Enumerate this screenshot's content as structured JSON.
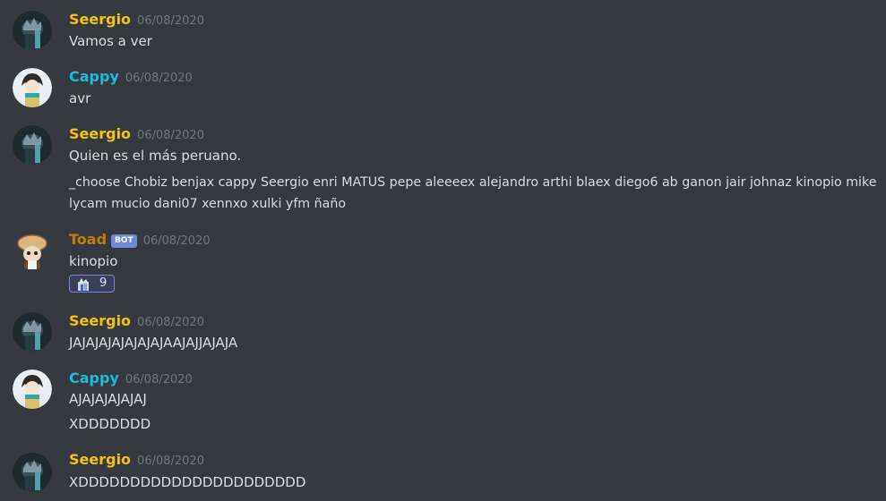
{
  "colors": {
    "background": "#36393f",
    "seergio_name": "#f1c40f",
    "cappy_name": "#1abcdc",
    "toad_name": "#c27c0e",
    "text": "#dcddde",
    "timestamp": "#72767d",
    "bot_tag": "#7289da"
  },
  "messages": [
    {
      "username": "Seergio",
      "avatar_icon": "dark-anime-avatar",
      "timestamp": "06/08/2020",
      "lines": [
        "Vamos a ver"
      ]
    },
    {
      "username": "Cappy",
      "avatar_icon": "anime-character-avatar",
      "timestamp": "06/08/2020",
      "lines": [
        "avr"
      ]
    },
    {
      "username": "Seergio",
      "avatar_icon": "dark-anime-avatar",
      "timestamp": "06/08/2020",
      "lines": [
        "Quien es el más peruano.",
        "_choose Chobiz benjax cappy Seergio enri MATUS pepe aleeeex alejandro arthi blaex diego6 ab ganon jair johnaz kinopio mike lycam mucio dani07 xennxo xulki yfm ñaño"
      ]
    },
    {
      "username": "Toad",
      "bot_tag": "BOT",
      "avatar_icon": "toad-explorer-avatar",
      "timestamp": "06/08/2020",
      "lines": [
        "kinopio"
      ],
      "reaction": {
        "emoji_icon": "character-emoji-icon",
        "count": "9"
      }
    },
    {
      "username": "Seergio",
      "avatar_icon": "dark-anime-avatar",
      "timestamp": "06/08/2020",
      "lines": [
        "JAJAJAJAJAJAJAJAAJAJJAJAJA"
      ]
    },
    {
      "username": "Cappy",
      "avatar_icon": "anime-character-avatar",
      "timestamp": "06/08/2020",
      "lines": [
        "AJAJAJAJAJAJ",
        "XDDDDDDD"
      ]
    },
    {
      "username": "Seergio",
      "avatar_icon": "dark-anime-avatar",
      "timestamp": "06/08/2020",
      "lines": [
        "XDDDDDDDDDDDDDDDDDDDDDD"
      ]
    }
  ]
}
